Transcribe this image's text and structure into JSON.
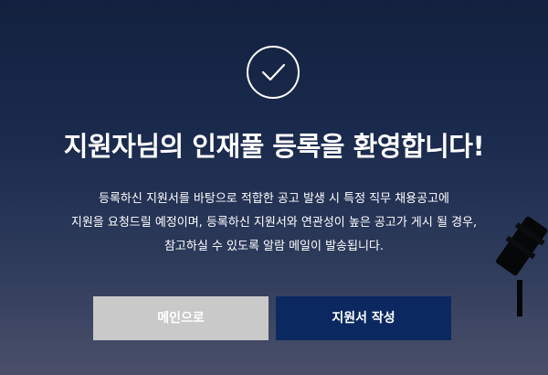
{
  "heading": {
    "title": "지원자님의 인재풀 등록을 환영합니다!"
  },
  "description": {
    "line1": "등록하신 지원서를 바탕으로 적합한 공고 발생 시 특정 직무 채용공고에",
    "line2": "지원을 요청드릴 예정이며, 등록하신 지원서와 연관성이 높은 공고가 게시 될 경우,",
    "line3": "참고하실 수 있도록 알람 메일이 발송됩니다."
  },
  "buttons": {
    "main_label": "메인으로",
    "write_label": "지원서 작성"
  },
  "icons": {
    "status": "check-circle-icon"
  },
  "colors": {
    "background_top": "#13213f",
    "background_bottom": "#4a4f69",
    "main_button": "#c9c9c9",
    "write_button": "#0b2860",
    "text": "#ffffff"
  }
}
